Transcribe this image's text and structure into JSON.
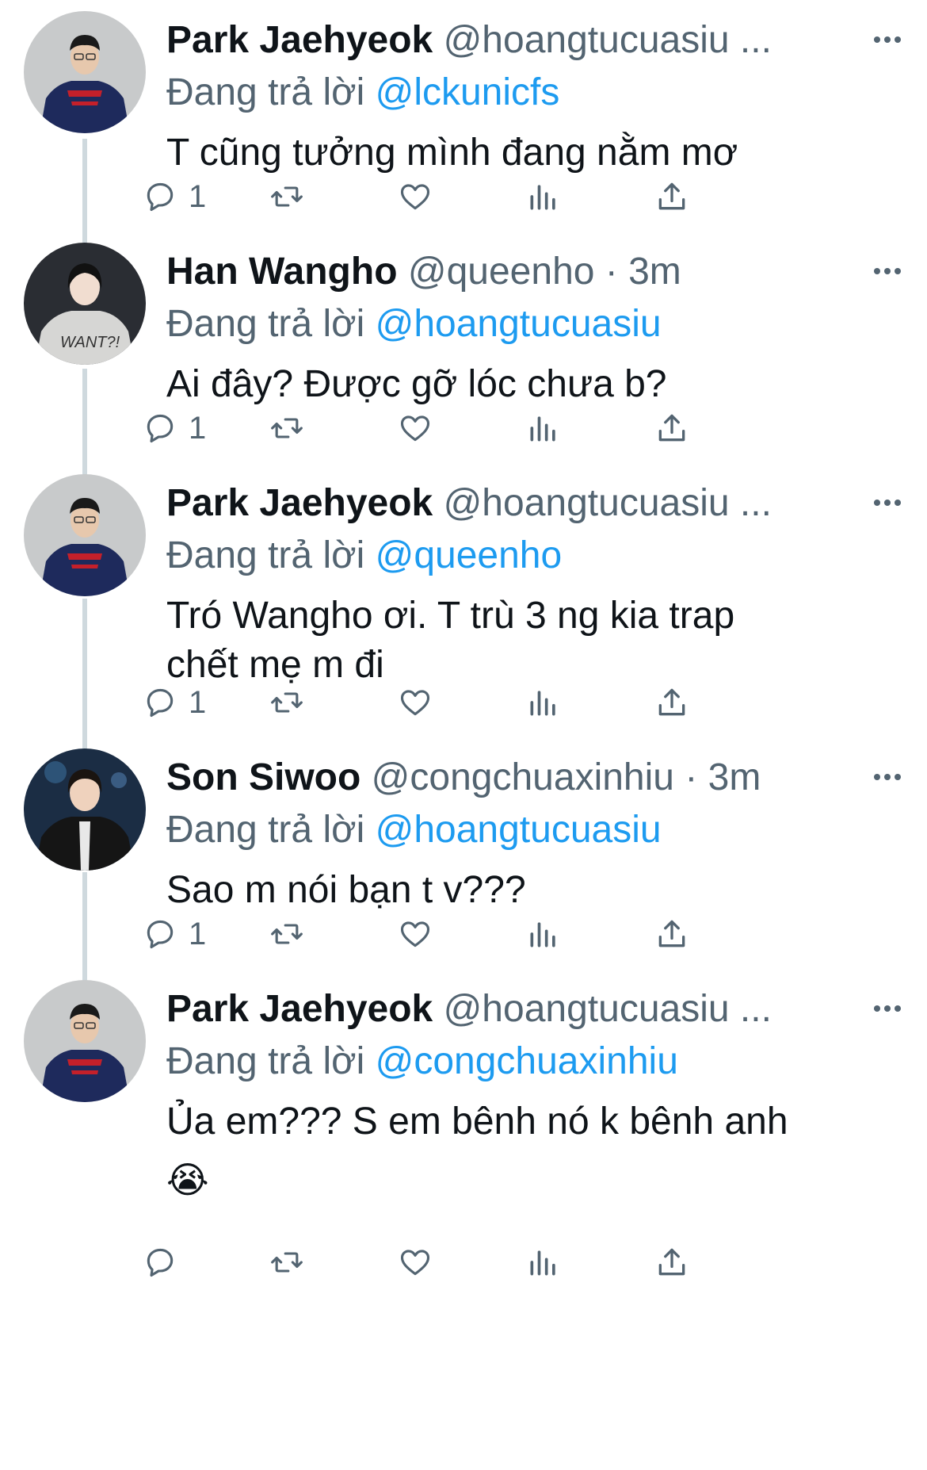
{
  "colors": {
    "name": "#0f1419",
    "secondary": "#536471",
    "mention": "#1d9bf0",
    "thread_line": "#cfd9de"
  },
  "tweets": [
    {
      "name": "Park Jaehyeok",
      "handle": "@hoangtucuasiu ...",
      "reply_prefix": "Đang trả lời",
      "reply_mention": "@lckunicfs",
      "text": "T cũng tưởng mình đang nằm mơ",
      "reply_count": "1",
      "avatar": "avatar-jersey"
    },
    {
      "name": "Han Wangho",
      "handle": "@queenho · 3m",
      "reply_prefix": "Đang trả lời",
      "reply_mention": "@hoangtucuasiu",
      "text": "Ai đây? Được gỡ lóc chưa b?",
      "reply_count": "1",
      "avatar": "avatar-hoodie"
    },
    {
      "name": "Park Jaehyeok",
      "handle": "@hoangtucuasiu ...",
      "reply_prefix": "Đang trả lời",
      "reply_mention": "@queenho",
      "text": "Tró Wangho ơi. T trù 3 ng kia trap chết mẹ m đi",
      "reply_count": "1",
      "avatar": "avatar-jersey"
    },
    {
      "name": "Son Siwoo",
      "handle": "@congchuaxinhiu · 3m",
      "reply_prefix": "Đang trả lời",
      "reply_mention": "@hoangtucuasiu",
      "text": "Sao m nói bạn t v???",
      "reply_count": "1",
      "avatar": "avatar-dark-jacket"
    },
    {
      "name": "Park Jaehyeok",
      "handle": "@hoangtucuasiu ...",
      "reply_prefix": "Đang trả lời",
      "reply_mention": "@congchuaxinhiu",
      "text": "Ủa em??? S em bênh nó k bênh anh",
      "emoji": "😭",
      "reply_count": "",
      "avatar": "avatar-jersey"
    }
  ]
}
